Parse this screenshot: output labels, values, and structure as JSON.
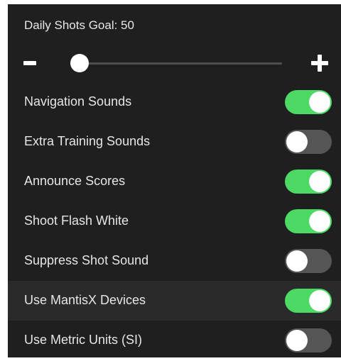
{
  "goal": {
    "label": "Daily Shots Goal: 50",
    "decrease_icon": "minus-icon",
    "increase_icon": "plus-icon",
    "slider_level": 0.0
  },
  "colors": {
    "panel_bg": "#1f1f1f",
    "toggle_on": "#4cd964",
    "toggle_off": "#555555",
    "highlight_row": "#2a2a2a"
  },
  "settings": [
    {
      "label": "Navigation Sounds",
      "on": true
    },
    {
      "label": "Extra Training Sounds",
      "on": false
    },
    {
      "label": "Announce Scores",
      "on": true
    },
    {
      "label": "Shoot Flash White",
      "on": true
    },
    {
      "label": "Suppress Shot Sound",
      "on": false
    },
    {
      "label": "Use MantisX Devices",
      "on": true,
      "highlighted": true
    },
    {
      "label": "Use Metric Units (SI)",
      "on": false
    }
  ]
}
